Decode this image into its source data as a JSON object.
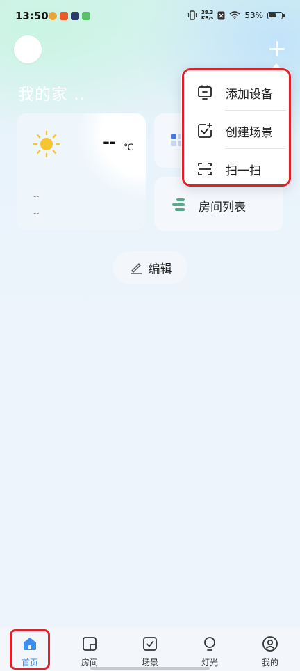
{
  "status_bar": {
    "time": "13:50",
    "net_speed_value": "38.3",
    "net_speed_unit": "KB/s",
    "battery": "53%"
  },
  "header": {
    "home_title": "我的家 .."
  },
  "weather": {
    "temperature": "--",
    "unit": "℃",
    "line1": "--",
    "line2": "--"
  },
  "cards": {
    "room_list_label": "房间列表"
  },
  "edit_button": {
    "label": "编辑"
  },
  "dropdown": {
    "items": [
      {
        "label": "添加设备",
        "icon": "add-device-icon"
      },
      {
        "label": "创建场景",
        "icon": "create-scene-icon"
      },
      {
        "label": "扫一扫",
        "icon": "scan-icon"
      }
    ]
  },
  "bottom_nav": {
    "items": [
      {
        "label": "首页",
        "icon": "home-icon",
        "active": true
      },
      {
        "label": "房间",
        "icon": "room-icon",
        "active": false
      },
      {
        "label": "场景",
        "icon": "scene-icon",
        "active": false
      },
      {
        "label": "灯光",
        "icon": "light-bulb-icon",
        "active": false
      },
      {
        "label": "我的",
        "icon": "profile-icon",
        "active": false
      }
    ]
  },
  "colors": {
    "accent": "#3b8ef0",
    "highlight": "#e0202a",
    "sun": "#f6c531",
    "list_icon": "#5aa88a"
  }
}
